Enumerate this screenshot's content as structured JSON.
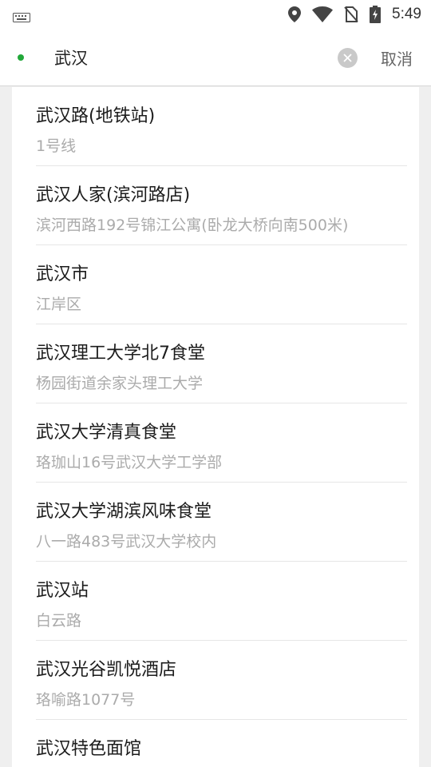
{
  "status_bar": {
    "time": "5:49",
    "icons": [
      "keyboard-icon",
      "location-icon",
      "wifi-icon",
      "no-sim-icon",
      "battery-charging-icon"
    ]
  },
  "search": {
    "query": "武汉",
    "cancel_label": "取消",
    "accent_color": "#22a83a"
  },
  "results": [
    {
      "name": "武汉路(地铁站)",
      "address": "1号线"
    },
    {
      "name": "武汉人家(滨河路店)",
      "address": "滨河西路192号锦江公寓(卧龙大桥向南500米)"
    },
    {
      "name": "武汉市",
      "address": "江岸区"
    },
    {
      "name": "武汉理工大学北7食堂",
      "address": "杨园街道余家头理工大学"
    },
    {
      "name": "武汉大学清真食堂",
      "address": "珞珈山16号武汉大学工学部"
    },
    {
      "name": "武汉大学湖滨风味食堂",
      "address": "八一路483号武汉大学校内"
    },
    {
      "name": "武汉站",
      "address": "白云路"
    },
    {
      "name": "武汉光谷凯悦酒店",
      "address": "珞喻路1077号"
    },
    {
      "name": "武汉特色面馆",
      "address": ""
    }
  ]
}
